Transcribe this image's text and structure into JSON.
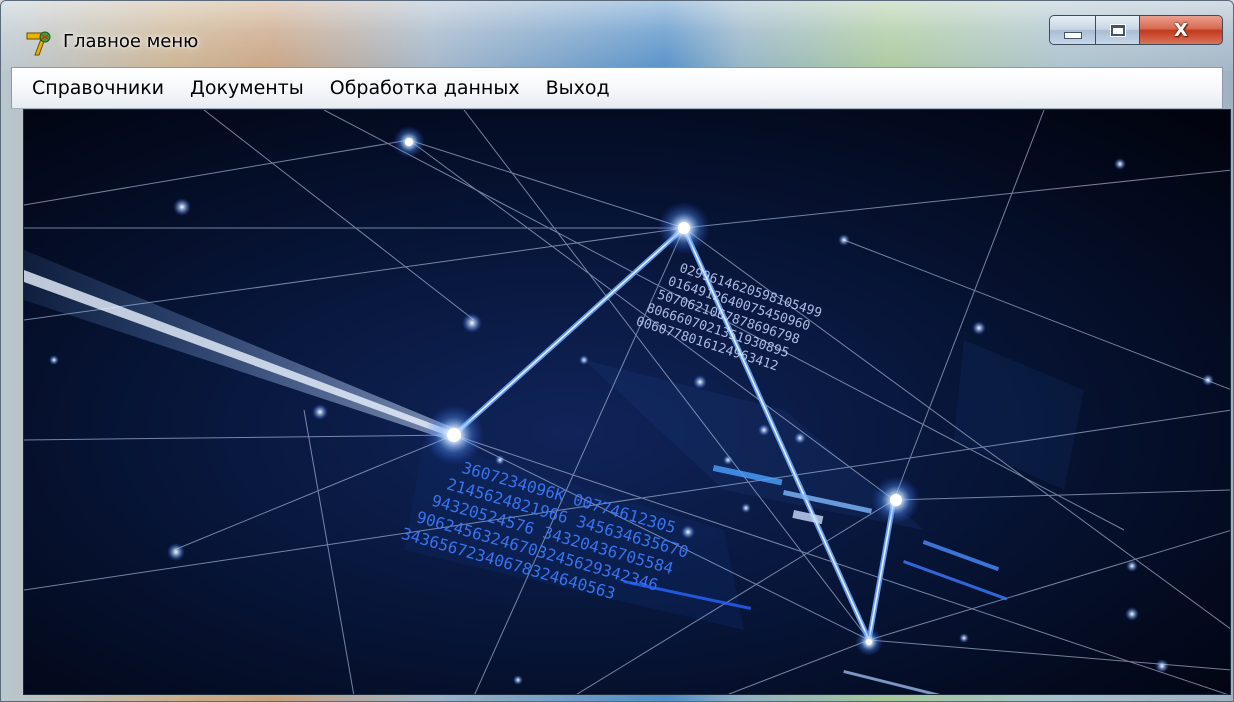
{
  "window": {
    "title": "Главное меню",
    "icon": "app-logo-icon",
    "caption_buttons": {
      "minimize_icon": "minimize-icon",
      "maximize_icon": "maximize-icon",
      "close_label": "X"
    }
  },
  "menubar": {
    "items": [
      {
        "label": "Справочники"
      },
      {
        "label": "Документы"
      },
      {
        "label": "Обработка данных"
      },
      {
        "label": "Выход"
      }
    ]
  },
  "colors": {
    "client_background": "#02061a",
    "network_glow": "#5a9cff",
    "close_button": "#c2391c"
  }
}
